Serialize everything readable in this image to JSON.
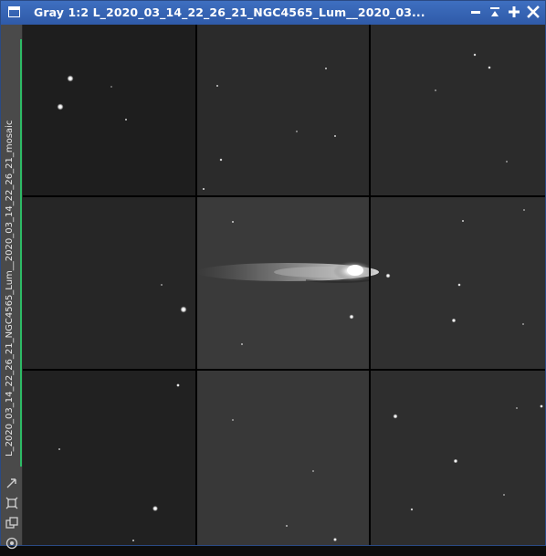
{
  "window": {
    "title": "Gray 1:2 L_2020_03_14_22_26_21_NGC4565_Lum__2020_03...",
    "controls": {
      "minimize": "minimize-icon",
      "shade": "shade-icon",
      "maximize": "maximize-icon",
      "close": "close-icon"
    }
  },
  "sidebar": {
    "view_tabs": [
      {
        "label": "L_2020_03_14_22_26_21_NGC4565_Lum__2020_03_14_22_26_21_mosaic",
        "active": true,
        "accent": "#2dbb66"
      }
    ],
    "tool_icons": [
      "resize-icon",
      "fit-view-icon",
      "clone-icon",
      "preview-icon"
    ]
  },
  "image": {
    "mode": "Gray",
    "zoom": "1:2",
    "mosaic_grid": {
      "rows": 3,
      "cols": 3
    },
    "tile_backgrounds": [
      [
        "#1e1e1e",
        "#2b2b2b",
        "#2b2b2b"
      ],
      [
        "#262626",
        "#3a3a3a",
        "#303030"
      ],
      [
        "#212121",
        "#383838",
        "#2e2e2e"
      ]
    ]
  },
  "colors": {
    "title_bar": "#2f5aa8",
    "sidebar": "#4a4a4a",
    "tab_accent": "#2dbb66",
    "separator": "#000000"
  }
}
